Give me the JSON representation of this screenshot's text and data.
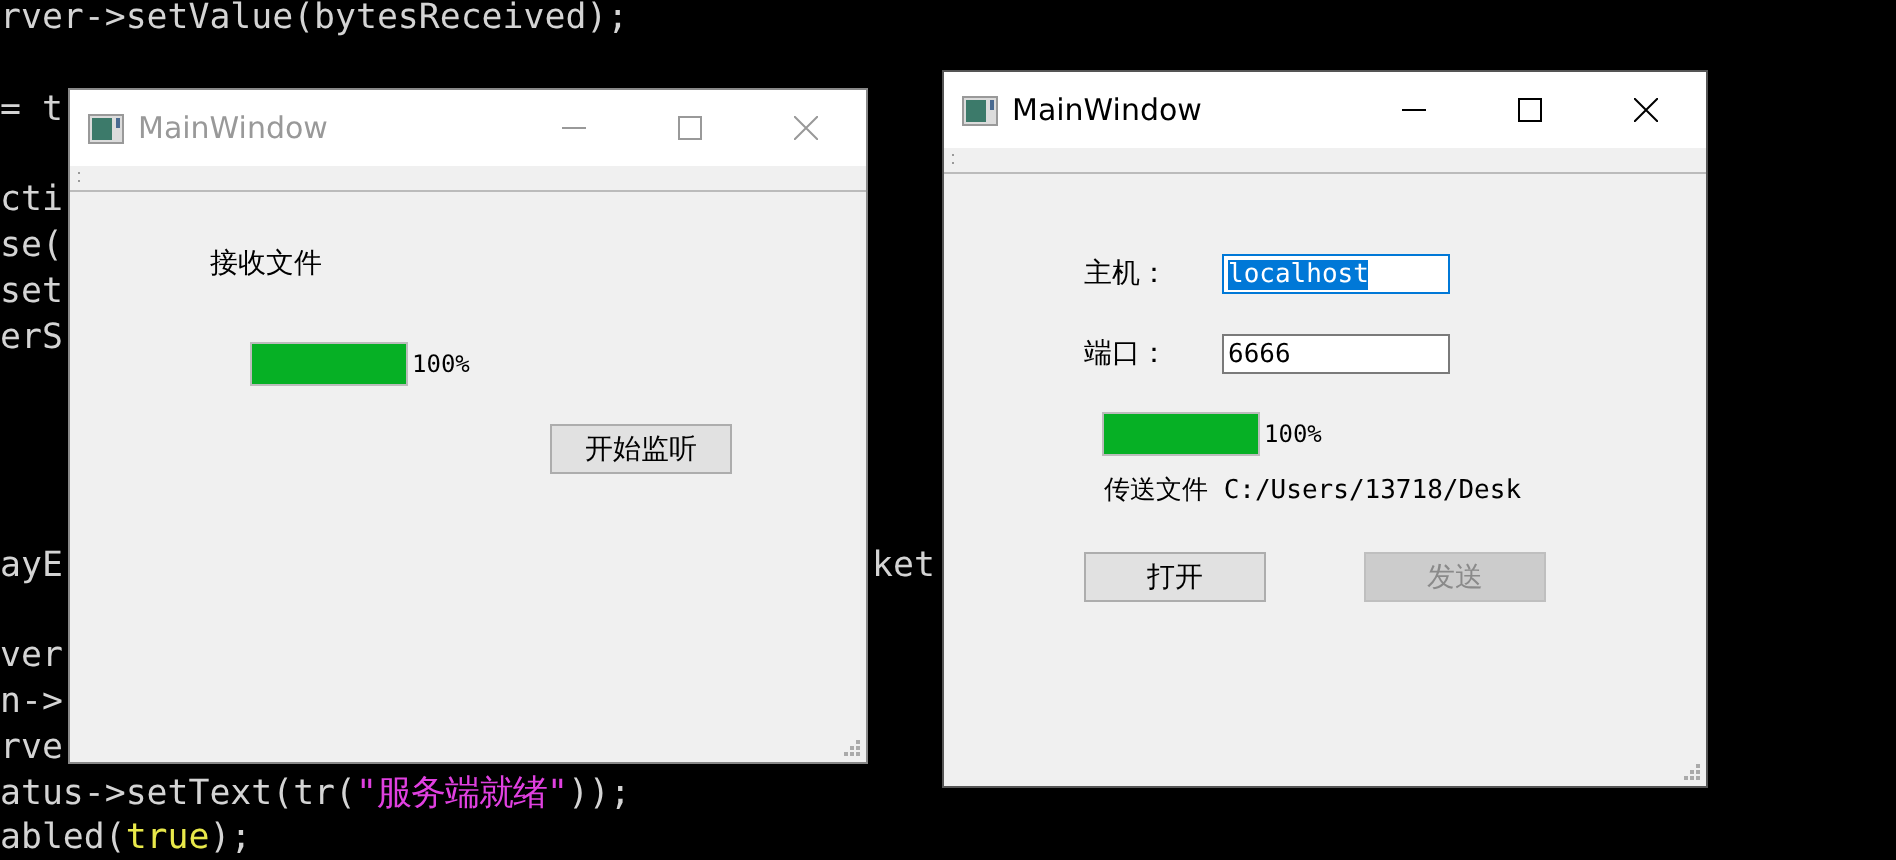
{
  "code_lines": [
    {
      "segments": [
        {
          "kind": "plain",
          "text": "rver->setValue(bytesReceived);"
        }
      ]
    },
    {
      "segments": [
        {
          "kind": "plain",
          "text": "= t"
        }
      ]
    },
    {
      "segments": [
        {
          "kind": "plain",
          "text": "cti"
        }
      ]
    },
    {
      "segments": [
        {
          "kind": "plain",
          "text": "se("
        }
      ]
    },
    {
      "segments": [
        {
          "kind": "plain",
          "text": "set"
        }
      ]
    },
    {
      "segments": [
        {
          "kind": "plain",
          "text": "erS"
        }
      ]
    },
    {
      "segments": [
        {
          "kind": "plain",
          "text": "ayE"
        }
      ],
      "right_text": "ket"
    },
    {
      "segments": [
        {
          "kind": "plain",
          "text": "ver"
        }
      ]
    },
    {
      "segments": [
        {
          "kind": "plain",
          "text": "n->"
        }
      ]
    },
    {
      "segments": [
        {
          "kind": "plain",
          "text": "rve"
        }
      ]
    },
    {
      "segments": [
        {
          "kind": "plain",
          "text": "atus->setText(tr("
        },
        {
          "kind": "string",
          "text": "\"服务端就绪\""
        },
        {
          "kind": "plain",
          "text": "));"
        }
      ]
    },
    {
      "segments": [
        {
          "kind": "plain",
          "text": "abled("
        },
        {
          "kind": "keyword",
          "text": "true"
        },
        {
          "kind": "plain",
          "text": ");"
        }
      ]
    }
  ],
  "windows": [
    {
      "title": "MainWindow",
      "active": false,
      "widgets": [
        {
          "kind": "label",
          "text": "接收文件"
        },
        {
          "kind": "progress",
          "level": 1,
          "reading": "100%"
        },
        {
          "kind": "buttons",
          "buttons": [
            {
              "label": "开始监听",
              "disabled": false
            }
          ]
        }
      ]
    },
    {
      "title": "MainWindow",
      "active": true,
      "widgets": [
        {
          "kind": "field",
          "label": "主机：",
          "value": "localhost",
          "focused": true,
          "text_selected": true
        },
        {
          "kind": "field",
          "label": "端口：",
          "value": "6666",
          "focused": false,
          "text_selected": false
        },
        {
          "kind": "progress",
          "level": 1,
          "reading": "100%"
        },
        {
          "kind": "label",
          "text": "传送文件 C:/Users/13718/Desk"
        },
        {
          "kind": "buttons",
          "buttons": [
            {
              "label": "打开",
              "disabled": false
            },
            {
              "label": "发送",
              "disabled": true
            }
          ]
        }
      ]
    }
  ]
}
